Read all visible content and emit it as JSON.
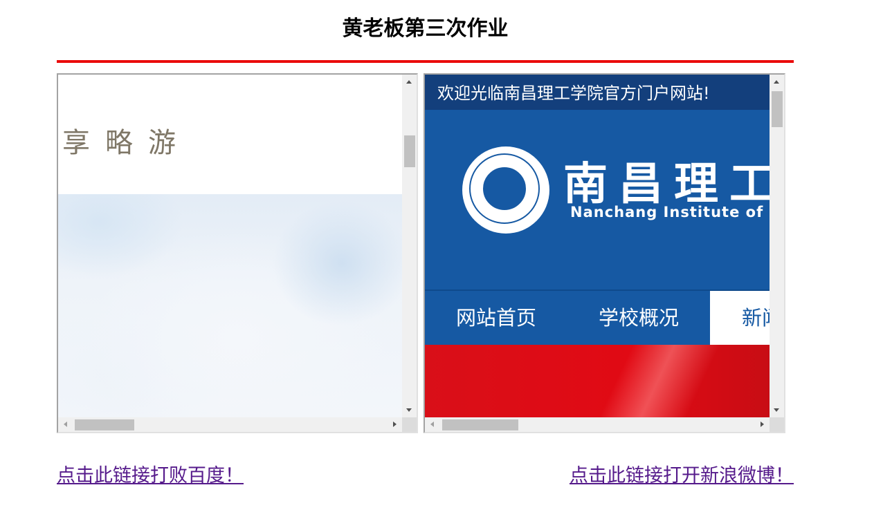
{
  "page": {
    "title": "黄老板第三次作业"
  },
  "left_frame": {
    "tagline": "享略游"
  },
  "right_frame": {
    "welcome": "欢迎光临南昌理工学院官方门户网站!",
    "school_name_cn": "南昌理工",
    "school_name_en": "Nanchang Institute of",
    "nav": [
      {
        "label": "网站首页"
      },
      {
        "label": "学校概况"
      },
      {
        "label": "新闻"
      }
    ],
    "colors": {
      "primary": "#1659a3",
      "hero": "#e10a14"
    }
  },
  "links": {
    "baidu": "点击此链接打败百度！",
    "weibo": "点击此链接打开新浪微博！"
  },
  "colors": {
    "rule": "#ea0a0a",
    "link_visited": "#551a8b"
  }
}
